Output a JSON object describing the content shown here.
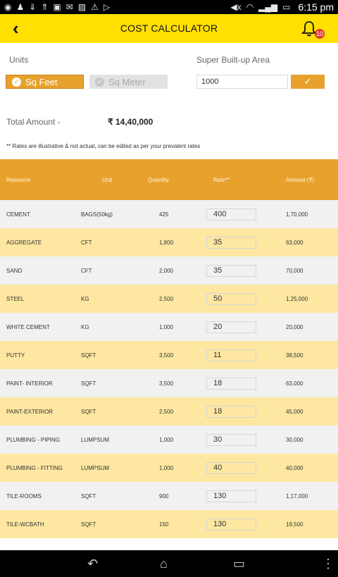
{
  "status_bar": {
    "time": "6:15 pm"
  },
  "app_bar": {
    "title": "COST CALCULATOR",
    "notification_count": "10"
  },
  "form": {
    "units_label": "Units",
    "area_label": "Super Built-up Area",
    "unit_options": [
      "Sq Feet",
      "Sq Meter"
    ],
    "selected_unit": "Sq Feet",
    "area_value": "1000",
    "apply_glyph": "✓"
  },
  "total": {
    "label": "Total Amount  -",
    "value": "₹ 14,40,000"
  },
  "note": "** Rates are illustrative & not actual, can be edited as per your prevalent rates",
  "table": {
    "headers": [
      "Resource",
      "Unit",
      "Quantity",
      "Rate**",
      "Amount (₹)"
    ],
    "rows": [
      {
        "resource": "CEMENT",
        "unit": "BAGS(50kg)",
        "quantity": "425",
        "rate": "400",
        "amount": "1,70,000"
      },
      {
        "resource": "AGGREGATE",
        "unit": "CFT",
        "quantity": "1,800",
        "rate": "35",
        "amount": "63,000"
      },
      {
        "resource": "SAND",
        "unit": "CFT",
        "quantity": "2,000",
        "rate": "35",
        "amount": "70,000"
      },
      {
        "resource": "STEEL",
        "unit": "KG",
        "quantity": "2,500",
        "rate": "50",
        "amount": "1,25,000"
      },
      {
        "resource": "WHITE CEMENT",
        "unit": "KG",
        "quantity": "1,000",
        "rate": "20",
        "amount": "20,000"
      },
      {
        "resource": "PUTTY",
        "unit": "SQFT",
        "quantity": "3,500",
        "rate": "11",
        "amount": "38,500"
      },
      {
        "resource": "PAINT- INTERIOR",
        "unit": "SQFT",
        "quantity": "3,500",
        "rate": "18",
        "amount": "63,000"
      },
      {
        "resource": "PAINT-EXTERIOR",
        "unit": "SQFT",
        "quantity": "2,500",
        "rate": "18",
        "amount": "45,000"
      },
      {
        "resource": "PLUMBING - PIPING",
        "unit": "LUMPSUM",
        "quantity": "1,000",
        "rate": "30",
        "amount": "30,000"
      },
      {
        "resource": "PLUMBING - FITTING",
        "unit": "LUMPSUM",
        "quantity": "1,000",
        "rate": "40",
        "amount": "40,000"
      },
      {
        "resource": "TILE-ROOMS",
        "unit": "SQFT",
        "quantity": "900",
        "rate": "130",
        "amount": "1,17,000"
      },
      {
        "resource": "TILE-WCBATH",
        "unit": "SQFT",
        "quantity": "150",
        "rate": "130",
        "amount": "19,500"
      }
    ]
  },
  "colors": {
    "accent": "#e8a12d",
    "app_bar": "#ffe000",
    "row_alt": "#fde7a1",
    "badge": "#e53935"
  },
  "icons": {
    "back": "back-arrow-icon",
    "notification": "bell-icon",
    "nav": [
      "nav-back-icon",
      "nav-home-icon",
      "nav-recents-icon",
      "nav-menu-icon"
    ]
  }
}
